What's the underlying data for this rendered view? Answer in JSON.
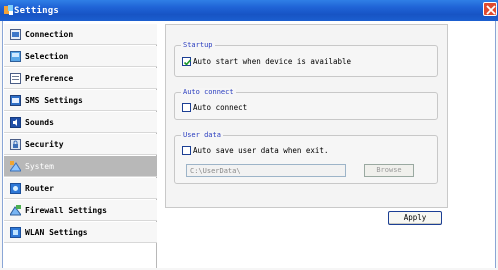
{
  "window": {
    "title": "Settings"
  },
  "sidebar": {
    "items": [
      {
        "label": "Connection",
        "icon": "connection-icon"
      },
      {
        "label": "Selection",
        "icon": "selection-icon"
      },
      {
        "label": "Preference",
        "icon": "preference-icon"
      },
      {
        "label": "SMS Settings",
        "icon": "sms-icon"
      },
      {
        "label": "Sounds",
        "icon": "sounds-icon"
      },
      {
        "label": "Security",
        "icon": "security-icon"
      },
      {
        "label": "System",
        "icon": "system-icon",
        "selected": true
      },
      {
        "label": "Router",
        "icon": "router-icon"
      },
      {
        "label": "Firewall Settings",
        "icon": "firewall-icon"
      },
      {
        "label": "WLAN Settings",
        "icon": "wlan-icon"
      }
    ]
  },
  "startup": {
    "title": "Startup",
    "auto_start_label": "Auto start when device is available",
    "auto_start_checked": true
  },
  "auto_connect": {
    "title": "Auto connect",
    "label": "Auto connect",
    "checked": false
  },
  "user_data": {
    "title": "User data",
    "auto_save_label": "Auto save user data when exit.",
    "auto_save_checked": false,
    "path_value": "C:\\UserData\\",
    "browse_label": "Browse"
  },
  "footer": {
    "apply_label": "Apply"
  },
  "colors": {
    "titlebar": "#1f63d6",
    "group_title": "#2a3dbf",
    "selected_item": "#b8b8b8",
    "close_button": "#e04a2f"
  }
}
